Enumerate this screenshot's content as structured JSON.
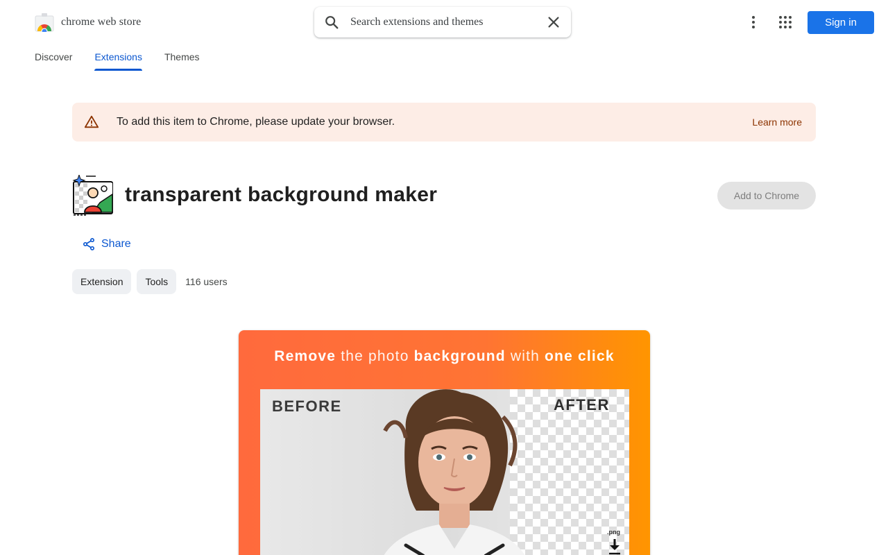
{
  "header": {
    "brand_name": "chrome web store",
    "search_placeholder": "Search extensions and themes",
    "signin_label": "Sign in"
  },
  "nav": {
    "tabs": [
      {
        "label": "Discover"
      },
      {
        "label": "Extensions"
      },
      {
        "label": "Themes"
      }
    ],
    "active_tab": "Extensions"
  },
  "banner": {
    "message": "To add this item to Chrome, please update your browser.",
    "link_label": "Learn more"
  },
  "extension": {
    "title": "transparent background maker",
    "add_button_label": "Add to Chrome",
    "share_label": "Share",
    "chips": [
      "Extension",
      "Tools"
    ],
    "users": "116 users"
  },
  "promo": {
    "headline": [
      {
        "text": "Remove",
        "bold": true
      },
      {
        "text": " the photo ",
        "bold": false
      },
      {
        "text": "background",
        "bold": true
      },
      {
        "text": " with ",
        "bold": false
      },
      {
        "text": "one click",
        "bold": true
      }
    ],
    "before_label": "BEFORE",
    "after_label": "AFTER",
    "file_label": ".png"
  },
  "colors": {
    "accent_blue": "#0b57d0",
    "signin_blue": "#1a73e8",
    "banner_bg": "#fdede6",
    "banner_link": "#8c3300",
    "promo_orange": "#ff7433"
  },
  "icons": [
    "chrome-web-store-logo",
    "search-icon",
    "close-icon",
    "more-vert-icon",
    "apps-grid-icon",
    "warning-icon",
    "extension-app-icon",
    "share-icon",
    "download-icon"
  ]
}
